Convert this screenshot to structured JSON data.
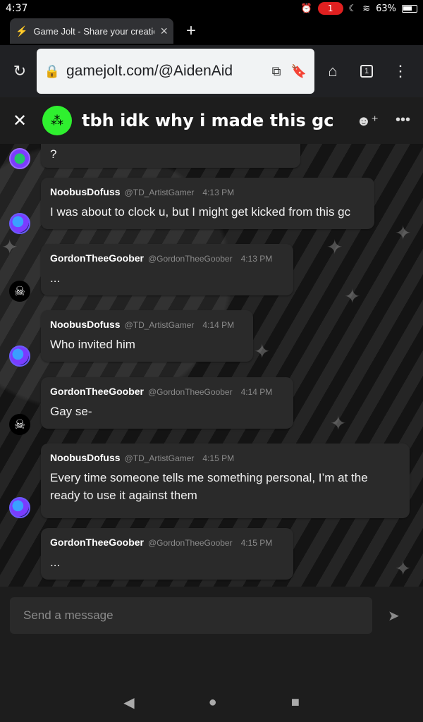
{
  "status_bar": {
    "time": "4:37",
    "notification_count": "1",
    "battery": "63%"
  },
  "browser": {
    "tab_title": "Game Jolt - Share your creations",
    "url": "gamejolt.com/@AidenAid",
    "tab_count": "1"
  },
  "chat": {
    "title": "tbh idk why i made this gc",
    "composer_placeholder": "Send a message",
    "partial_message_text": "?",
    "messages": [
      {
        "name": "NoobusDofuss",
        "handle": "@TD_ArtistGamer",
        "time": "4:13 PM",
        "text": "I was about to clock u, but I might get kicked from this gc"
      },
      {
        "name": "GordonTheeGoober",
        "handle": "@GordonTheeGoober",
        "time": "4:13 PM",
        "text": "..."
      },
      {
        "name": "NoobusDofuss",
        "handle": "@TD_ArtistGamer",
        "time": "4:14 PM",
        "text": "Who invited him"
      },
      {
        "name": "GordonTheeGoober",
        "handle": "@GordonTheeGoober",
        "time": "4:14 PM",
        "text": "Gay se-"
      },
      {
        "name": "NoobusDofuss",
        "handle": "@TD_ArtistGamer",
        "time": "4:15 PM",
        "text": "Every time someone tells me something personal, I’m at the ready to use it against them"
      },
      {
        "name": "GordonTheeGoober",
        "handle": "@GordonTheeGoober",
        "time": "4:15 PM",
        "text": "..."
      }
    ]
  },
  "colors": {
    "group_avatar": "#2ff02f",
    "bubble": "#2a2a2a",
    "header": "#1d1d1d",
    "notification": "#e02020"
  }
}
